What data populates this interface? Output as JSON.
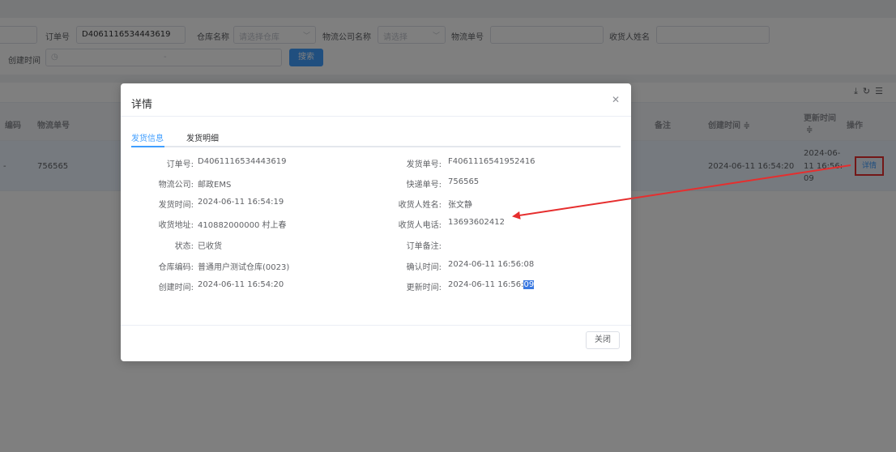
{
  "filters": {
    "order_no_label": "订单号",
    "order_no_value": "D4061116534443619",
    "warehouse_label": "仓库名称",
    "warehouse_placeholder": "请选择仓库",
    "logistics_company_label": "物流公司名称",
    "logistics_company_placeholder": "请选择",
    "tracking_no_label": "物流单号",
    "receiver_name_label": "收货人姓名",
    "create_time_label": "创建时间",
    "create_time_sep": "-",
    "search_label": "搜索"
  },
  "toolbar_icons": {
    "download": "download-icon",
    "refresh": "refresh-icon",
    "columns": "columns-icon"
  },
  "table": {
    "headers": {
      "code": "编码",
      "tracking_no": "物流单号",
      "remark": "备注",
      "create_time": "创建时间 ≑",
      "update_time_1": "更新时间",
      "update_time_2": "≑",
      "action": "操作"
    },
    "row": {
      "dash": "-",
      "tracking_no": "756565",
      "create_time": "2024-06-11 16:54:20",
      "update_time_l1": "2024-06-",
      "update_time_l2": "11 16:56:",
      "update_time_l3": "09",
      "detail": "详情"
    }
  },
  "modal": {
    "title": "详情",
    "close_icon": "close-icon",
    "tabs": [
      "发货信息",
      "发货明细"
    ],
    "left": [
      {
        "label": "订单号:",
        "value": "D4061116534443619"
      },
      {
        "label": "物流公司:",
        "value": "邮政EMS"
      },
      {
        "label": "发货时间:",
        "value": "2024-06-11 16:54:19"
      },
      {
        "label": "收货地址:",
        "value": "410882000000 村上春"
      },
      {
        "label": "状态:",
        "value": "已收货"
      },
      {
        "label": "仓库编码:",
        "value": "普通用户测试仓库(0023)"
      },
      {
        "label": "创建时间:",
        "value": "2024-06-11 16:54:20"
      }
    ],
    "right": [
      {
        "label": "发货单号:",
        "value": "F4061116541952416"
      },
      {
        "label": "快递单号:",
        "value": "756565"
      },
      {
        "label": "收货人姓名:",
        "value": "张文静"
      },
      {
        "label": "收货人电话:",
        "value": "13693602412"
      },
      {
        "label": "订单备注:",
        "value": ""
      },
      {
        "label": "确认时间:",
        "value": "2024-06-11 16:56:08"
      },
      {
        "label": "更新时间:",
        "value": "2024-06-11 16:56:",
        "selected": "09"
      }
    ],
    "close_button": "关闭"
  },
  "annotation_color": "#e62e2e"
}
